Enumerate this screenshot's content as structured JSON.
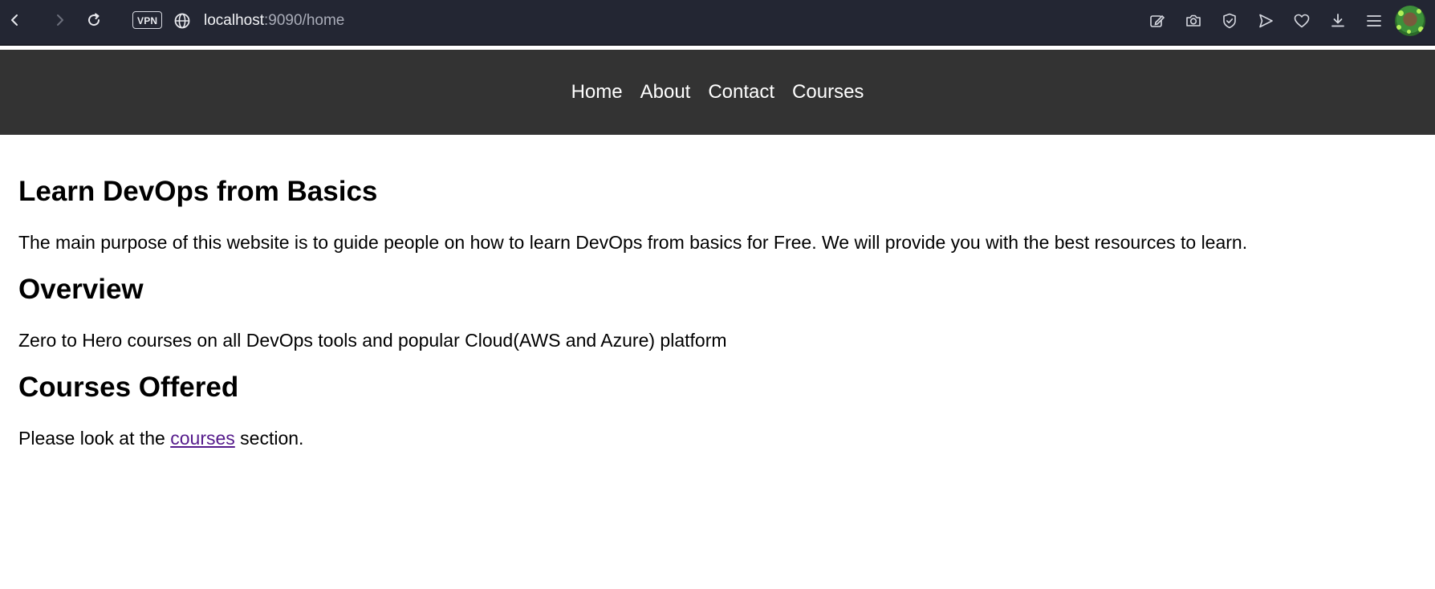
{
  "browser": {
    "url_host": "localhost",
    "url_path": ":9090/home",
    "vpn_label": "VPN",
    "icons": [
      "back-icon",
      "forward-icon",
      "reload-icon",
      "globe-icon",
      "edit-icon",
      "camera-icon",
      "shield-icon",
      "send-icon",
      "heart-icon",
      "download-icon",
      "menu-icon"
    ]
  },
  "nav": {
    "items": [
      "Home",
      "About",
      "Contact",
      "Courses"
    ],
    "background": "#333333"
  },
  "main": {
    "title": "Learn DevOps from Basics",
    "intro": "The main purpose of this website is to guide people on how to learn DevOps from basics for Free. We will provide you with the best resources to learn.",
    "overview_heading": "Overview",
    "overview_text": "Zero to Hero courses on all DevOps tools and popular Cloud(AWS and Azure) platform",
    "courses_heading": "Courses Offered",
    "courses_text_before": "Please look at the ",
    "courses_link": "courses",
    "courses_text_after": " section.",
    "link_color": "#551a8b"
  }
}
